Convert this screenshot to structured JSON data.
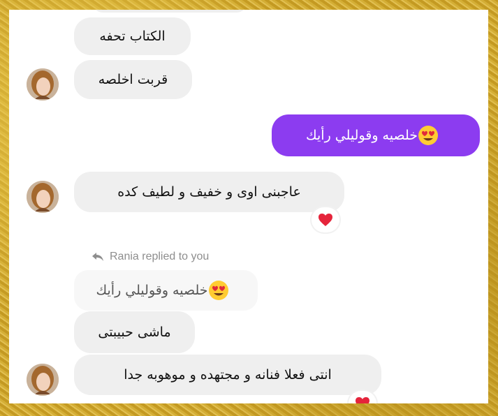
{
  "conversation": {
    "messages": [
      {
        "text": "الكتاب تحفه",
        "from": "them"
      },
      {
        "text": "قربت اخلصه",
        "from": "them"
      },
      {
        "text": "خلصيه وقوليلي رأيك",
        "emoji": "heart-eyes",
        "from": "me"
      },
      {
        "text": "عاجبنى اوى و خفيف و لطيف كده",
        "from": "them",
        "reaction": "red-heart"
      },
      {
        "reply_label": "Rania replied to you",
        "quoted_text": "خلصيه وقوليلي رأيك",
        "quoted_emoji": "heart-eyes"
      },
      {
        "text": "ماشى حبيبتى",
        "from": "them"
      },
      {
        "text": "انتى فعلا فنانه و مجتهده و موهوبه جدا",
        "from": "them",
        "reaction": "red-heart"
      }
    ]
  },
  "colors": {
    "sent_bubble": "#8c3cf0",
    "received_bubble": "#efefef",
    "frame_border": "#c9a22a"
  },
  "icons": [
    "heart-eyes-emoji",
    "red-heart-icon",
    "reply-arrow-icon",
    "avatar"
  ]
}
